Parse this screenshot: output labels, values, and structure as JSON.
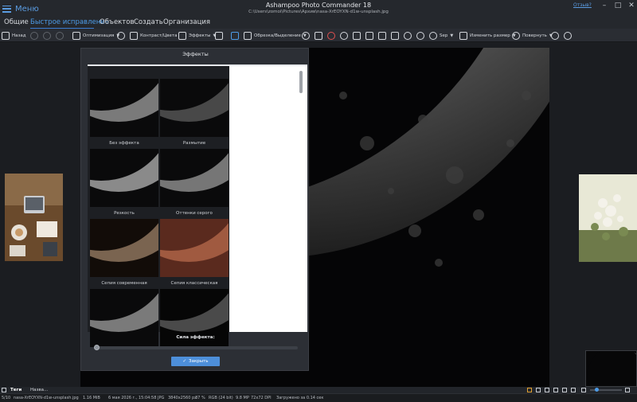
{
  "title_bar": {
    "menu_label": "Меню",
    "app_title": "Ashampoo Photo Commander 18",
    "file_path": "C:\\Users\\zomoi\\Pictures\\Архив\\nasa-XrEOYXN-d1w-unsplash.jpg",
    "feedback_link": "Отзыв?"
  },
  "tabs": [
    {
      "label": "Общие",
      "active": false
    },
    {
      "label": "Быстрое исправление",
      "active": true
    },
    {
      "label": "Объектов",
      "active": false
    },
    {
      "label": "Создать",
      "active": false
    },
    {
      "label": "Организация",
      "active": false
    }
  ],
  "toolbar": {
    "back_label": "Назад",
    "optimize_label": "Оптимизация",
    "contrast_label": "Контраст/Цвета",
    "effects_label": "Эффекты",
    "crop_label": "Обрезка/Выделение",
    "sep_label": "Sep",
    "resize_label": "Изменить размер",
    "rotate_label": "Повернуть"
  },
  "effects_panel": {
    "title": "Эффекты",
    "tiles": [
      {
        "label": "Без эффекта",
        "style": "plain"
      },
      {
        "label": "Размытие",
        "style": "blur"
      },
      {
        "label": "Резкость",
        "style": "sharp"
      },
      {
        "label": "Оттенки серого",
        "style": "gray"
      },
      {
        "label": "Сепия современная",
        "style": "sepia-modern"
      },
      {
        "label": "Сепия классическая",
        "style": "sepia-classic"
      },
      {
        "label": "",
        "style": "plain"
      },
      {
        "label": "",
        "style": "dark"
      }
    ],
    "strength_label": "Сила эффекта:",
    "strength_value": 0,
    "apply_label": "Закрыть"
  },
  "bottom_tabs": [
    {
      "label": "Теги",
      "active": true
    },
    {
      "label": "Назва...",
      "active": false
    }
  ],
  "status_bar": {
    "index": "5/10",
    "filename": "nasa-XrEOYXN-d1w-unsplash.jpg",
    "filesize": "1.16 MiB",
    "date": "6 мая 2026 г., 15:04:58",
    "format": "JPG",
    "dimensions": "3840x2560 px",
    "zoom": "37 %",
    "color": "RGB (24 bit)",
    "megapixels": "9.8 MP",
    "dpi": "72x72 DPI",
    "load_time": "Загружено за 0.14 сек"
  },
  "colors": {
    "accent": "#4d9be6",
    "background": "#1b1d21",
    "panel": "#2c2f35",
    "apply_button": "#4d8fda"
  }
}
